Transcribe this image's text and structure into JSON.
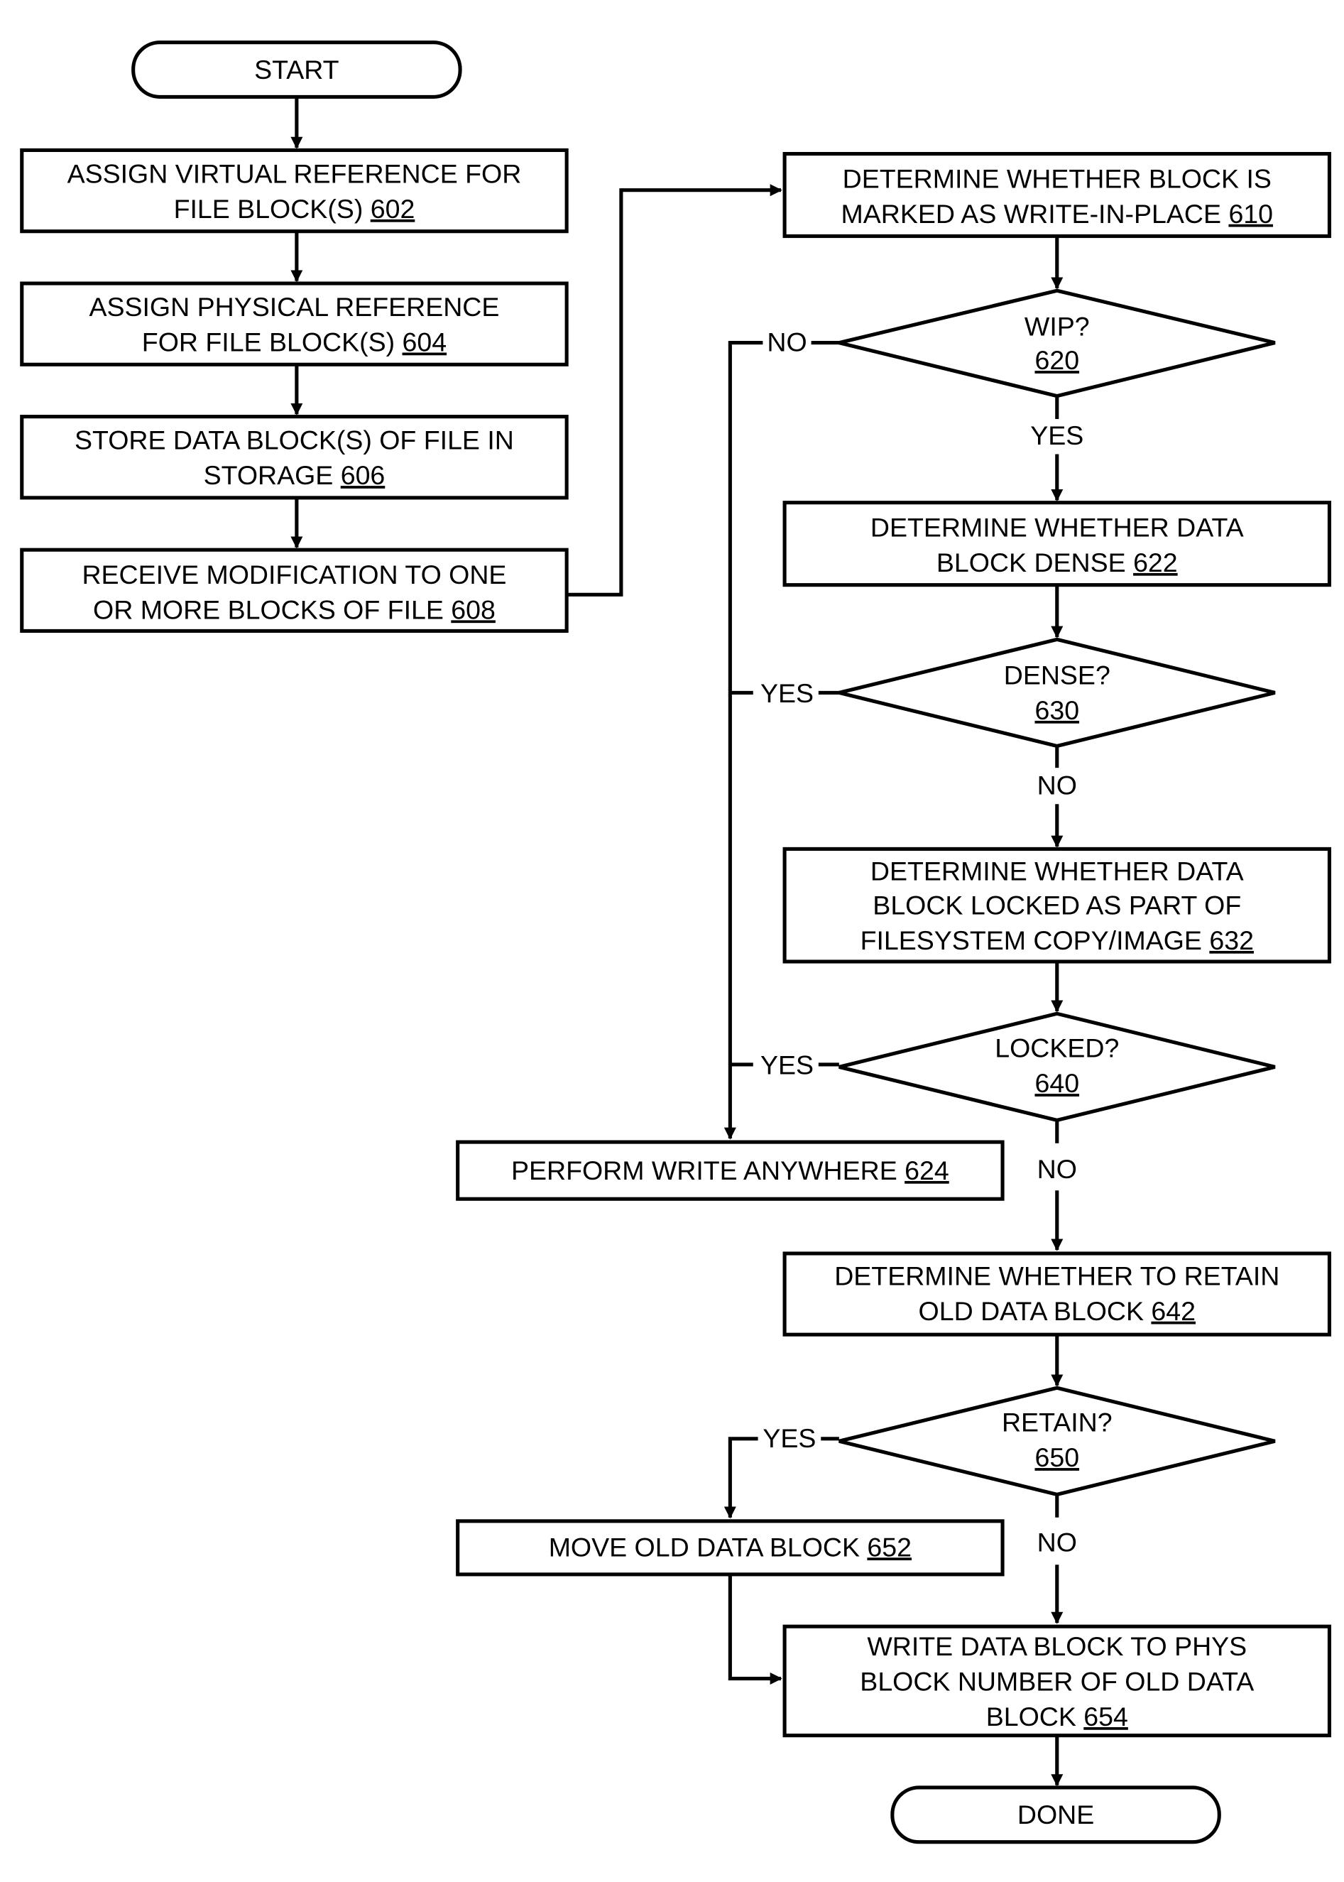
{
  "nodes": {
    "start": {
      "label": "START"
    },
    "n602": {
      "lines": [
        "ASSIGN VIRTUAL REFERENCE FOR",
        "FILE BLOCK(S) "
      ],
      "ref": "602"
    },
    "n604": {
      "lines": [
        "ASSIGN PHYSICAL REFERENCE",
        "FOR FILE BLOCK(S) "
      ],
      "ref": "604"
    },
    "n606": {
      "lines": [
        "STORE DATA BLOCK(S) OF FILE IN",
        "STORAGE "
      ],
      "ref": "606"
    },
    "n608": {
      "lines": [
        "RECEIVE MODIFICATION TO ONE",
        "OR MORE BLOCKS OF FILE "
      ],
      "ref": "608"
    },
    "n610": {
      "lines": [
        "DETERMINE WHETHER BLOCK IS",
        "MARKED AS WRITE-IN-PLACE "
      ],
      "ref": "610"
    },
    "d620": {
      "label": "WIP?",
      "ref": "620"
    },
    "n622": {
      "lines": [
        "DETERMINE WHETHER DATA",
        "BLOCK DENSE "
      ],
      "ref": "622"
    },
    "d630": {
      "label": "DENSE?",
      "ref": "630"
    },
    "n632": {
      "lines": [
        "DETERMINE WHETHER DATA",
        "BLOCK LOCKED AS PART OF",
        "FILESYSTEM COPY/IMAGE "
      ],
      "ref": "632"
    },
    "d640": {
      "label": "LOCKED?",
      "ref": "640"
    },
    "n624": {
      "lines": [
        "PERFORM WRITE ANYWHERE "
      ],
      "ref": "624"
    },
    "n642": {
      "lines": [
        "DETERMINE WHETHER TO RETAIN",
        "OLD DATA BLOCK "
      ],
      "ref": "642"
    },
    "d650": {
      "label": "RETAIN?",
      "ref": "650"
    },
    "n652": {
      "lines": [
        "MOVE OLD DATA BLOCK "
      ],
      "ref": "652"
    },
    "n654": {
      "lines": [
        "WRITE DATA BLOCK TO PHYS",
        "BLOCK NUMBER OF OLD DATA",
        "BLOCK  "
      ],
      "ref": "654"
    },
    "done": {
      "label": "DONE"
    }
  },
  "edge_labels": {
    "wip_no": "NO",
    "wip_yes": "YES",
    "dense_yes": "YES",
    "dense_no": "NO",
    "locked_yes": "YES",
    "locked_no": "NO",
    "retain_yes": "YES",
    "retain_no": "NO"
  }
}
